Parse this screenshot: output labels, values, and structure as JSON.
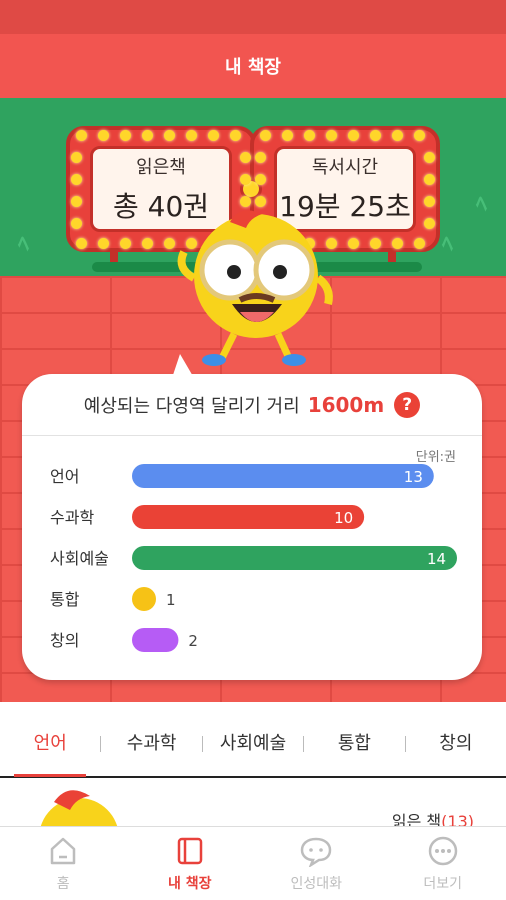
{
  "header": {
    "title": "내 책장"
  },
  "stats": {
    "books_label": "읽은책",
    "books_value": "총 40권",
    "time_label": "독서시간",
    "time_value": "19분 25초"
  },
  "distance": {
    "label": "예상되는 다영역 달리기 거리",
    "value": "1600m",
    "help_glyph": "?"
  },
  "chart_data": {
    "type": "bar",
    "orientation": "horizontal",
    "unit_label": "단위:권",
    "categories": [
      "언어",
      "수과학",
      "사회예술",
      "통합",
      "창의"
    ],
    "values": [
      13,
      10,
      14,
      1,
      2
    ],
    "colors": [
      "#5b8def",
      "#ea4236",
      "#2fa35f",
      "#f6c216",
      "#b65cf5"
    ],
    "xlim": [
      0,
      14
    ]
  },
  "tabs": [
    {
      "label": "언어",
      "active": true
    },
    {
      "label": "수과학",
      "active": false
    },
    {
      "label": "사회예술",
      "active": false
    },
    {
      "label": "통합",
      "active": false
    },
    {
      "label": "창의",
      "active": false
    }
  ],
  "list_preview": {
    "count_label": "읽은 책",
    "count_value": "(13)"
  },
  "bottom_nav": [
    {
      "label": "홈",
      "icon": "home-icon",
      "active": false
    },
    {
      "label": "내 책장",
      "icon": "bookshelf-icon",
      "active": true
    },
    {
      "label": "인성대화",
      "icon": "chat-icon",
      "active": false
    },
    {
      "label": "더보기",
      "icon": "more-icon",
      "active": false
    }
  ],
  "colors": {
    "brand_red": "#f25550",
    "accent_red": "#e8413b",
    "grass_green": "#2fa35f",
    "bulb_yellow": "#ffd62a"
  }
}
